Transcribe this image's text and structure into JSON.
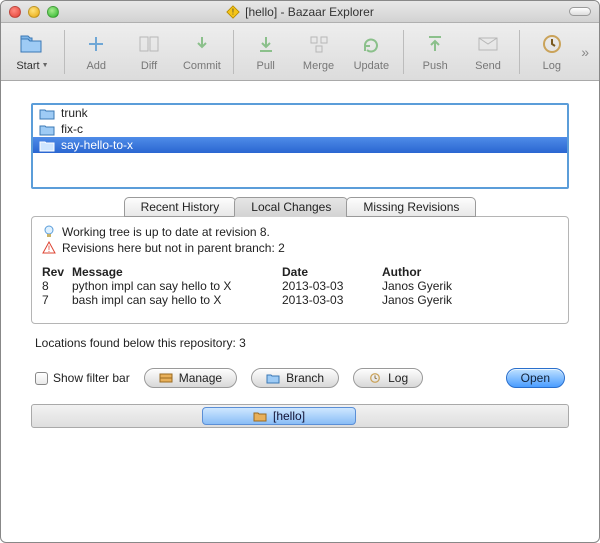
{
  "window": {
    "title": "[hello] - Bazaar Explorer"
  },
  "toolbar": {
    "start": "Start",
    "add": "Add",
    "diff": "Diff",
    "commit": "Commit",
    "pull": "Pull",
    "merge": "Merge",
    "update": "Update",
    "push": "Push",
    "send": "Send",
    "log": "Log"
  },
  "branches": {
    "items": [
      {
        "name": "trunk",
        "selected": false
      },
      {
        "name": "fix-c",
        "selected": false
      },
      {
        "name": "say-hello-to-x",
        "selected": true
      }
    ]
  },
  "tabs": {
    "recent": "Recent History",
    "local": "Local Changes",
    "missing": "Missing Revisions",
    "active": "local"
  },
  "status": {
    "uptodate": "Working tree is up to date at revision 8.",
    "missing": "Revisions here but not in parent branch: 2"
  },
  "table": {
    "headers": {
      "rev": "Rev",
      "message": "Message",
      "date": "Date",
      "author": "Author"
    },
    "rows": [
      {
        "rev": "8",
        "message": "python impl can say hello to X",
        "date": "2013-03-03",
        "author": "Janos Gyerik"
      },
      {
        "rev": "7",
        "message": "bash impl can say hello to X",
        "date": "2013-03-03",
        "author": "Janos Gyerik"
      }
    ]
  },
  "locations_line": "Locations found below this repository: 3",
  "bottom": {
    "show_filter": "Show filter bar",
    "manage": "Manage",
    "branch": "Branch",
    "log": "Log",
    "open": "Open"
  },
  "breadcrumb": {
    "label": "[hello]"
  }
}
